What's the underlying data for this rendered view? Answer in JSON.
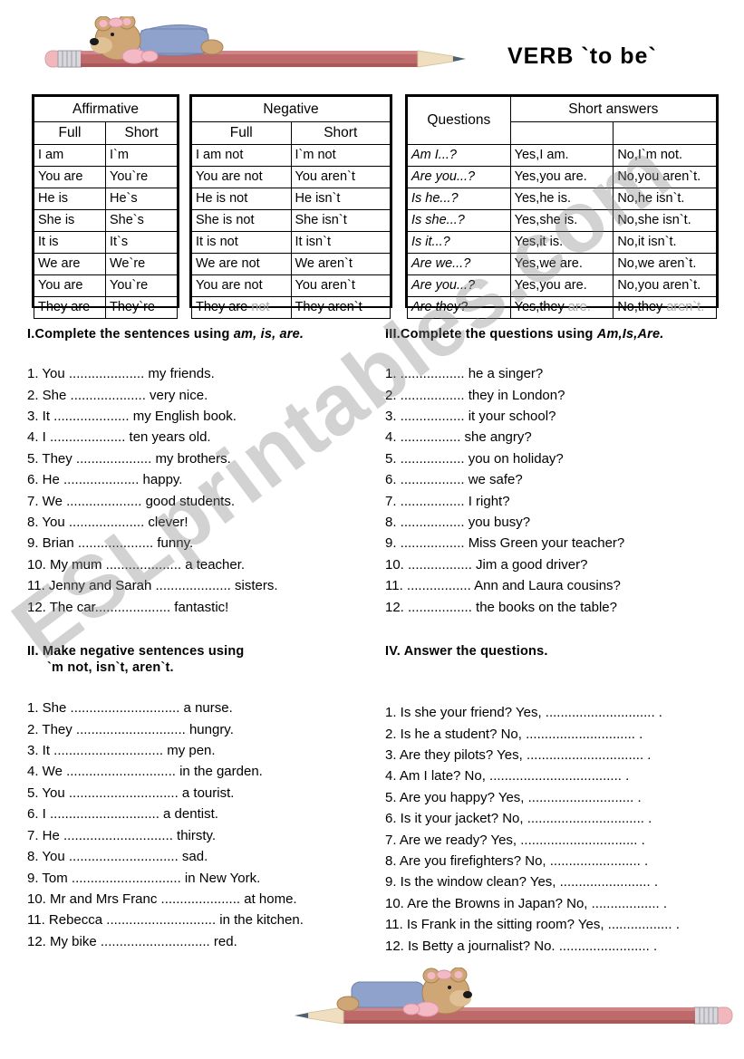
{
  "page": {
    "title": "VERB `to be`",
    "watermark": "ESLprintables.com"
  },
  "tables": {
    "affirmative": {
      "title": "Affirmative",
      "columns": [
        "Full",
        "Short"
      ],
      "rows": [
        [
          "I am",
          "I`m"
        ],
        [
          "You are",
          "You`re"
        ],
        [
          "He is",
          "He`s"
        ],
        [
          "She is",
          "She`s"
        ],
        [
          "It is",
          "It`s"
        ],
        [
          "We are",
          "We`re"
        ],
        [
          "You are",
          "You`re"
        ],
        [
          "They are",
          "They`re"
        ]
      ]
    },
    "negative": {
      "title": "Negative",
      "columns": [
        "Full",
        "Short"
      ],
      "rows": [
        [
          "I am not",
          "I`m not"
        ],
        [
          "You are not",
          "You aren`t"
        ],
        [
          "He is not",
          "He isn`t"
        ],
        [
          "She is not",
          "She isn`t"
        ],
        [
          "It is not",
          "It isn`t"
        ],
        [
          "We are not",
          "We aren`t"
        ],
        [
          "You are not",
          "You aren`t"
        ],
        [
          "They are ",
          "They aren`t"
        ]
      ],
      "last_row_faint_suffix": "not"
    },
    "questions": {
      "title_questions": "Questions",
      "title_answers": "Short answers",
      "rows": [
        [
          "Am I...?",
          "Yes,I am.",
          "No,I`m not."
        ],
        [
          "Are you...?",
          "Yes,you are.",
          "No,you aren`t."
        ],
        [
          "Is he...?",
          "Yes,he is.",
          "No,he isn`t."
        ],
        [
          "Is she...?",
          "Yes,she is.",
          "No,she isn`t."
        ],
        [
          "Is it...?",
          "Yes,it is.",
          "No,it isn`t."
        ],
        [
          "Are we...?",
          "Yes,we are.",
          "No,we aren`t."
        ],
        [
          "Are you...?",
          "Yes,you are.",
          "No,you aren`t."
        ],
        [
          "Are they?",
          "Yes,they ",
          "No,they "
        ]
      ],
      "last_row_faint_yes": "are.",
      "last_row_faint_no": "aren`t."
    }
  },
  "exercises": {
    "one": {
      "heading_prefix": "I.Complete the sentences using ",
      "heading_keywords": "am, is, are.",
      "items": [
        "1. You .................... my friends.",
        "2. She .................... very nice.",
        "3. It .................... my English book.",
        "4. I  .................... ten years old.",
        "5. They .................... my brothers.",
        "6. He .................... happy.",
        "7. We .................... good students.",
        "8. You .................... clever!",
        "9. Brian .................... funny.",
        "10. My mum .................... a teacher.",
        "11. Jenny and Sarah .................... sisters.",
        "12. The car.................... fantastic!"
      ]
    },
    "two": {
      "heading_line1": "II. Make negative sentences using",
      "heading_line2": "`m not, isn`t,  aren`t.",
      "items": [
        "1. She ............................. a nurse.",
        "2. They ............................. hungry.",
        "3. It ............................. my pen.",
        "4. We ............................. in the garden.",
        "5. You ............................. a tourist.",
        "6. I ............................. a dentist.",
        "7. He ............................. thirsty.",
        "8. You ............................. sad.",
        "9. Tom ............................. in New York.",
        "10. Mr and  Mrs Franc ..................... at home.",
        "11. Rebecca ............................. in the kitchen.",
        "12. My bike ............................. red."
      ]
    },
    "three": {
      "heading_prefix": "III.Complete the questions using ",
      "heading_keywords": "Am,Is,Are.",
      "items": [
        "1. ................. he a singer?",
        "2. ................. they in London?",
        "3. ................. it your school?",
        "4. ................ she angry?",
        "5. ................. you on holiday?",
        "6. ................. we safe?",
        "7. ................. I right?",
        "8. ................. you busy?",
        "9. ................. Miss Green your teacher?",
        "10. ................. Jim a good driver?",
        "11. ................. Ann and Laura cousins?",
        "12. ................. the books on the table?"
      ]
    },
    "four": {
      "heading": "IV.  Answer the questions.",
      "items": [
        "1. Is she your friend?  Yes, ............................. .",
        "2. Is he a student?   No, ............................. .",
        "3. Are they pilots?  Yes, ............................... .",
        "4. Am I late?    No, ................................... .",
        "5. Are you happy?   Yes, ............................ .",
        "6. Is it your jacket?   No, ............................... .",
        "7. Are we ready? Yes, ............................... .",
        "8. Are you firefighters?   No, ........................ .",
        "9. Is the window clean?   Yes, ........................ .",
        "10. Are the Browns in Japan?   No, .................. .",
        "11. Is Frank in the sitting room? Yes, ................. .",
        "12. Is Betty a journalist?  No. ........................ ."
      ]
    }
  },
  "decor": {
    "pencil_color": "#bf6a6a",
    "pencil_eraser_color": "#f0b8bc",
    "pencil_ferrule_color": "#d8d8dd",
    "pencil_wood_color": "#efdfc0",
    "pencil_lead_color": "#4d6070",
    "bear_fur_color": "#cfa776",
    "bear_shirt_color": "#8fa2cc",
    "bear_bow_color": "#f3b9c4"
  }
}
